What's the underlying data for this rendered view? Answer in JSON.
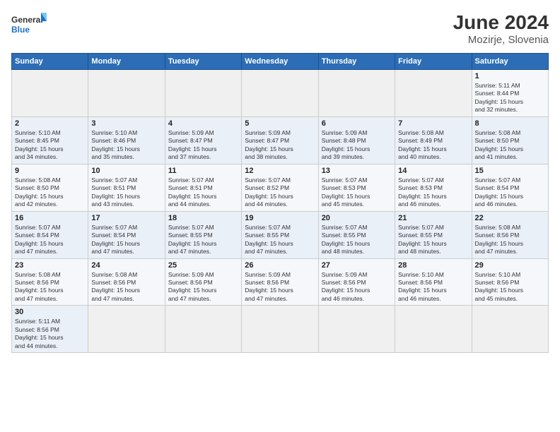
{
  "header": {
    "logo_general": "General",
    "logo_blue": "Blue",
    "month_year": "June 2024",
    "location": "Mozirje, Slovenia"
  },
  "weekdays": [
    "Sunday",
    "Monday",
    "Tuesday",
    "Wednesday",
    "Thursday",
    "Friday",
    "Saturday"
  ],
  "weeks": [
    [
      {
        "day": "",
        "info": ""
      },
      {
        "day": "",
        "info": ""
      },
      {
        "day": "",
        "info": ""
      },
      {
        "day": "",
        "info": ""
      },
      {
        "day": "",
        "info": ""
      },
      {
        "day": "",
        "info": ""
      },
      {
        "day": "1",
        "info": "Sunrise: 5:11 AM\nSunset: 8:44 PM\nDaylight: 15 hours\nand 32 minutes."
      }
    ],
    [
      {
        "day": "2",
        "info": "Sunrise: 5:10 AM\nSunset: 8:45 PM\nDaylight: 15 hours\nand 34 minutes."
      },
      {
        "day": "3",
        "info": "Sunrise: 5:10 AM\nSunset: 8:46 PM\nDaylight: 15 hours\nand 35 minutes."
      },
      {
        "day": "4",
        "info": "Sunrise: 5:09 AM\nSunset: 8:47 PM\nDaylight: 15 hours\nand 37 minutes."
      },
      {
        "day": "5",
        "info": "Sunrise: 5:09 AM\nSunset: 8:47 PM\nDaylight: 15 hours\nand 38 minutes."
      },
      {
        "day": "6",
        "info": "Sunrise: 5:09 AM\nSunset: 8:48 PM\nDaylight: 15 hours\nand 39 minutes."
      },
      {
        "day": "7",
        "info": "Sunrise: 5:08 AM\nSunset: 8:49 PM\nDaylight: 15 hours\nand 40 minutes."
      },
      {
        "day": "8",
        "info": "Sunrise: 5:08 AM\nSunset: 8:50 PM\nDaylight: 15 hours\nand 41 minutes."
      }
    ],
    [
      {
        "day": "9",
        "info": "Sunrise: 5:08 AM\nSunset: 8:50 PM\nDaylight: 15 hours\nand 42 minutes."
      },
      {
        "day": "10",
        "info": "Sunrise: 5:07 AM\nSunset: 8:51 PM\nDaylight: 15 hours\nand 43 minutes."
      },
      {
        "day": "11",
        "info": "Sunrise: 5:07 AM\nSunset: 8:51 PM\nDaylight: 15 hours\nand 44 minutes."
      },
      {
        "day": "12",
        "info": "Sunrise: 5:07 AM\nSunset: 8:52 PM\nDaylight: 15 hours\nand 44 minutes."
      },
      {
        "day": "13",
        "info": "Sunrise: 5:07 AM\nSunset: 8:53 PM\nDaylight: 15 hours\nand 45 minutes."
      },
      {
        "day": "14",
        "info": "Sunrise: 5:07 AM\nSunset: 8:53 PM\nDaylight: 15 hours\nand 46 minutes."
      },
      {
        "day": "15",
        "info": "Sunrise: 5:07 AM\nSunset: 8:54 PM\nDaylight: 15 hours\nand 46 minutes."
      }
    ],
    [
      {
        "day": "16",
        "info": "Sunrise: 5:07 AM\nSunset: 8:54 PM\nDaylight: 15 hours\nand 47 minutes."
      },
      {
        "day": "17",
        "info": "Sunrise: 5:07 AM\nSunset: 8:54 PM\nDaylight: 15 hours\nand 47 minutes."
      },
      {
        "day": "18",
        "info": "Sunrise: 5:07 AM\nSunset: 8:55 PM\nDaylight: 15 hours\nand 47 minutes."
      },
      {
        "day": "19",
        "info": "Sunrise: 5:07 AM\nSunset: 8:55 PM\nDaylight: 15 hours\nand 47 minutes."
      },
      {
        "day": "20",
        "info": "Sunrise: 5:07 AM\nSunset: 8:55 PM\nDaylight: 15 hours\nand 48 minutes."
      },
      {
        "day": "21",
        "info": "Sunrise: 5:07 AM\nSunset: 8:55 PM\nDaylight: 15 hours\nand 48 minutes."
      },
      {
        "day": "22",
        "info": "Sunrise: 5:08 AM\nSunset: 8:56 PM\nDaylight: 15 hours\nand 47 minutes."
      }
    ],
    [
      {
        "day": "23",
        "info": "Sunrise: 5:08 AM\nSunset: 8:56 PM\nDaylight: 15 hours\nand 47 minutes."
      },
      {
        "day": "24",
        "info": "Sunrise: 5:08 AM\nSunset: 8:56 PM\nDaylight: 15 hours\nand 47 minutes."
      },
      {
        "day": "25",
        "info": "Sunrise: 5:09 AM\nSunset: 8:56 PM\nDaylight: 15 hours\nand 47 minutes."
      },
      {
        "day": "26",
        "info": "Sunrise: 5:09 AM\nSunset: 8:56 PM\nDaylight: 15 hours\nand 47 minutes."
      },
      {
        "day": "27",
        "info": "Sunrise: 5:09 AM\nSunset: 8:56 PM\nDaylight: 15 hours\nand 46 minutes."
      },
      {
        "day": "28",
        "info": "Sunrise: 5:10 AM\nSunset: 8:56 PM\nDaylight: 15 hours\nand 46 minutes."
      },
      {
        "day": "29",
        "info": "Sunrise: 5:10 AM\nSunset: 8:56 PM\nDaylight: 15 hours\nand 45 minutes."
      }
    ],
    [
      {
        "day": "30",
        "info": "Sunrise: 5:11 AM\nSunset: 8:56 PM\nDaylight: 15 hours\nand 44 minutes."
      },
      {
        "day": "",
        "info": ""
      },
      {
        "day": "",
        "info": ""
      },
      {
        "day": "",
        "info": ""
      },
      {
        "day": "",
        "info": ""
      },
      {
        "day": "",
        "info": ""
      },
      {
        "day": "",
        "info": ""
      }
    ]
  ]
}
